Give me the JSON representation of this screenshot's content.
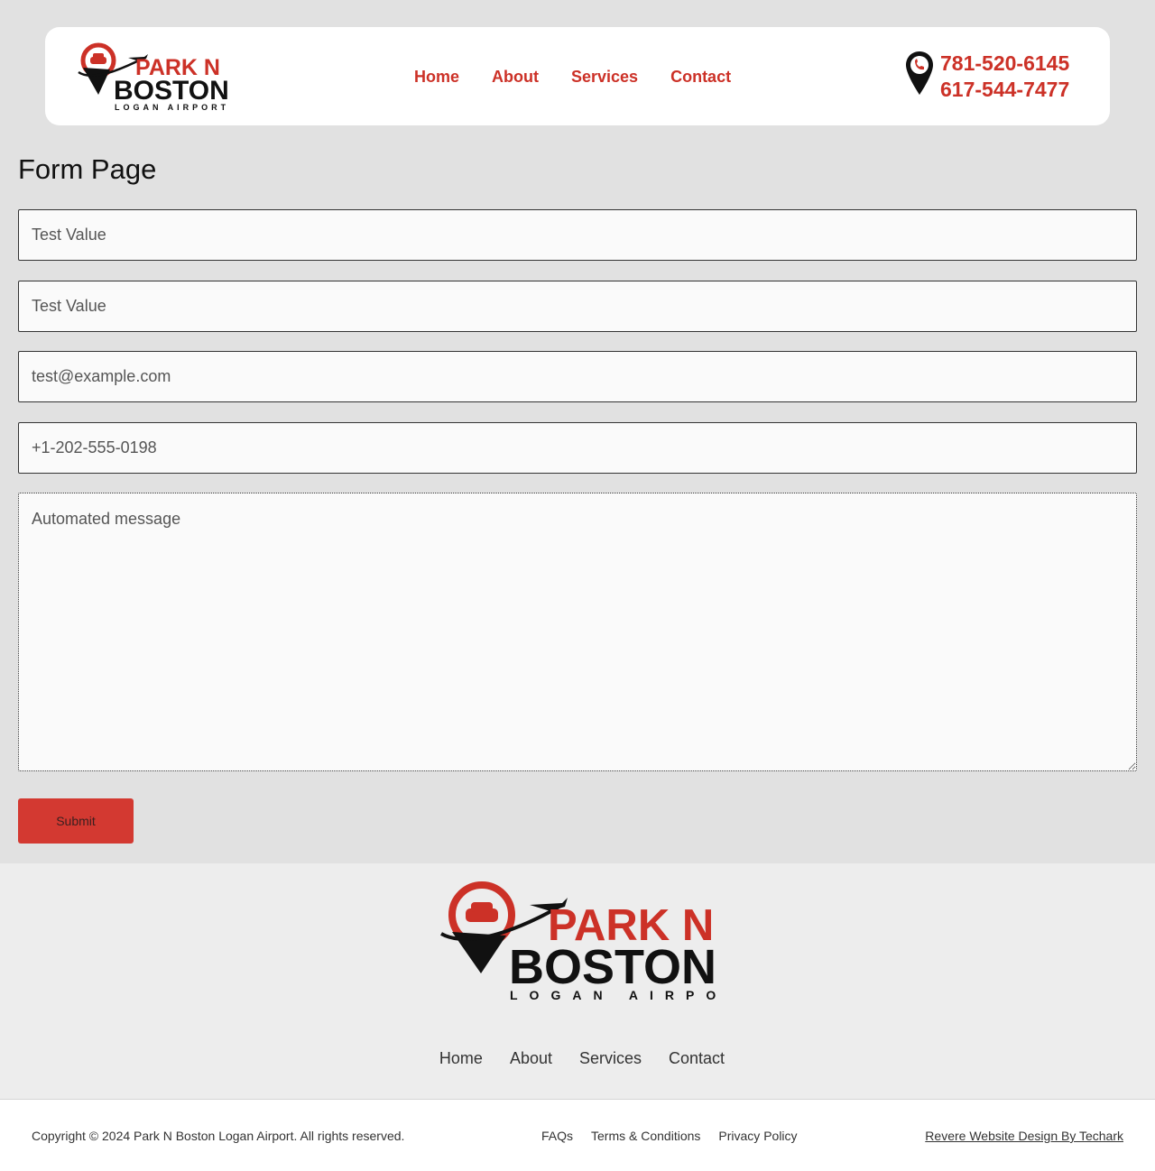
{
  "brand": {
    "line1": "PARK N",
    "line2": "BOSTON",
    "line3": "LOGAN AIRPORT",
    "red": "#cc3127",
    "dark": "#111111"
  },
  "header": {
    "nav": [
      "Home",
      "About",
      "Services",
      "Contact"
    ],
    "phones": [
      "781-520-6145",
      "617-544-7477"
    ],
    "phone_icon": "location-pin-phone-icon"
  },
  "form": {
    "title": "Form Page",
    "fields": {
      "first": "Test Value",
      "second": "Test Value",
      "email": "test@example.com",
      "phone": "+1-202-555-0198",
      "message": "Automated message"
    },
    "submit_label": "Submit",
    "submit_color": "#d33931"
  },
  "footer": {
    "nav": [
      "Home",
      "About",
      "Services",
      "Contact"
    ],
    "copyright": "Copyright © 2024 Park N Boston Logan Airport. All rights reserved.",
    "legal": [
      "FAQs",
      "Terms & Conditions",
      "Privacy Policy"
    ],
    "credit": "Revere Website Design By Techark"
  }
}
